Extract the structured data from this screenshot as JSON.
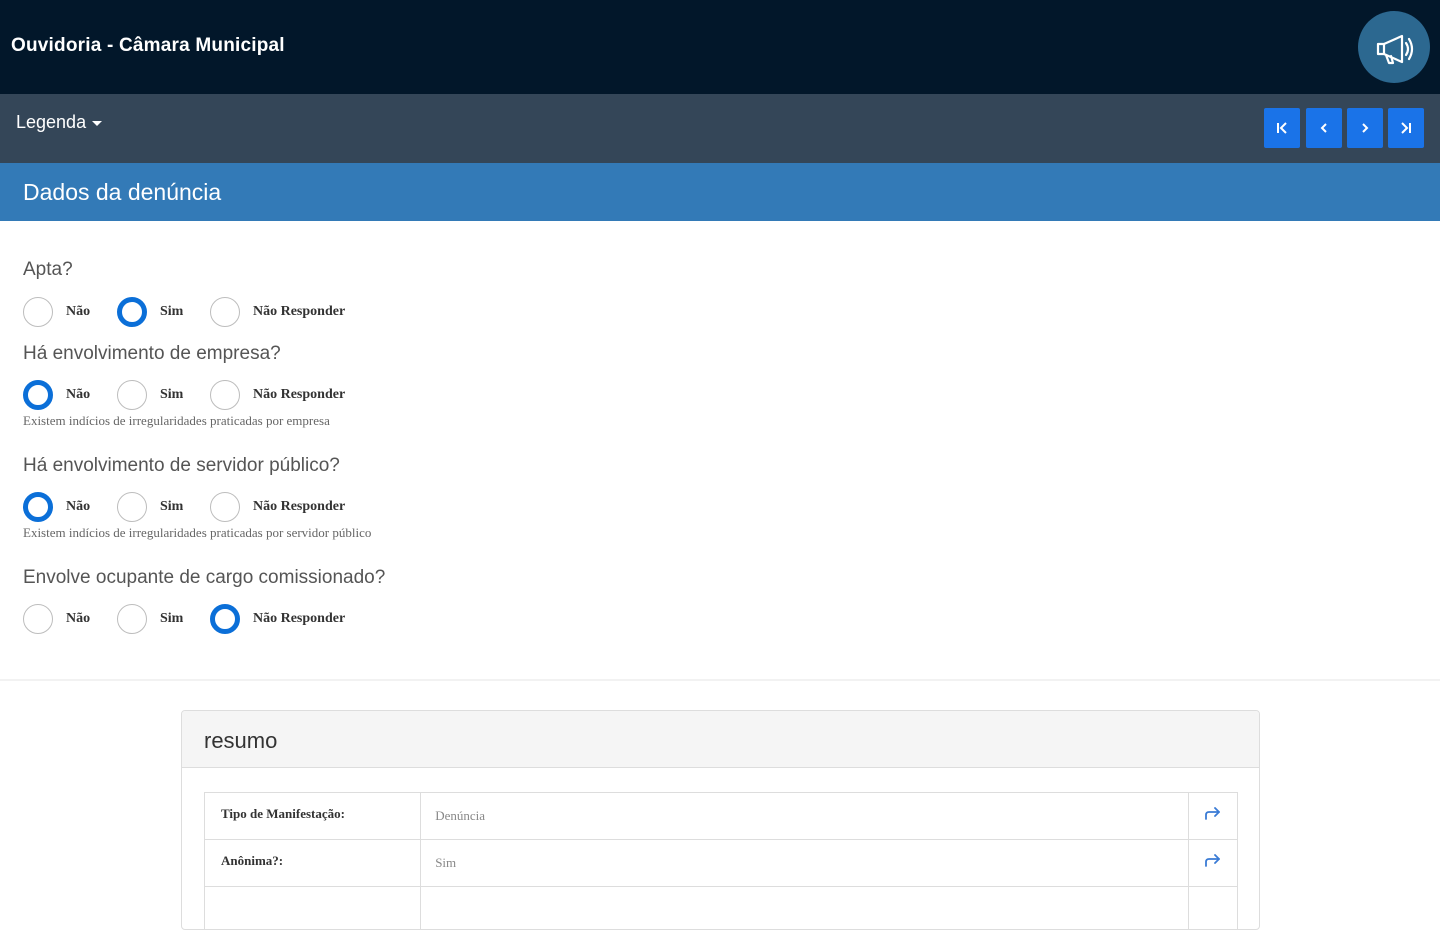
{
  "header": {
    "title": "Ouvidoria - Câmara Municipal"
  },
  "toolbar": {
    "legend_label": "Legenda",
    "pager": [
      {
        "icon": "first-page-icon"
      },
      {
        "icon": "previous-page-icon"
      },
      {
        "icon": "next-page-icon"
      },
      {
        "icon": "last-page-icon"
      }
    ]
  },
  "section": {
    "title": "Dados da denúncia"
  },
  "questions": [
    {
      "label": "Apta?",
      "options": [
        "Não",
        "Sim",
        "Não Responder"
      ],
      "selected": 1,
      "hint": ""
    },
    {
      "label": "Há envolvimento de empresa?",
      "options": [
        "Não",
        "Sim",
        "Não Responder"
      ],
      "selected": 0,
      "hint": "Existem indícios de irregularidades praticadas por empresa"
    },
    {
      "label": "Há envolvimento de servidor público?",
      "options": [
        "Não",
        "Sim",
        "Não Responder"
      ],
      "selected": 0,
      "hint": "Existem indícios de irregularidades praticadas por servidor público"
    },
    {
      "label": "Envolve ocupante de cargo comissionado?",
      "options": [
        "Não",
        "Sim",
        "Não Responder"
      ],
      "selected": 2,
      "hint": ""
    }
  ],
  "summary": {
    "title": "resumo",
    "rows": [
      {
        "key": "Tipo de Manifestação:",
        "value": "Denúncia"
      },
      {
        "key": "Anônima?:",
        "value": "Sim"
      },
      {
        "key": "",
        "value": ""
      }
    ]
  },
  "colors": {
    "topbar": "#02172a",
    "subbar": "#344658",
    "section_header": "#337ab7",
    "accent": "#1a73e8",
    "radio_selected": "#0b6fd8"
  }
}
